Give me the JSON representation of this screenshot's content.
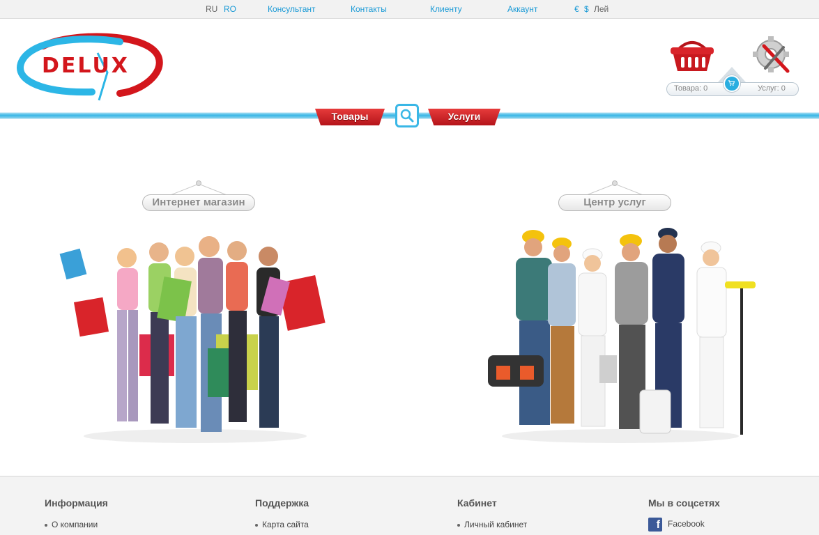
{
  "topbar": {
    "lang_ru": "RU",
    "lang_ro": "RO",
    "consultant": "Консультант",
    "contacts": "Контакты",
    "client": "Клиенту",
    "account": "Аккаунт",
    "cur_eur": "€",
    "cur_usd": "$",
    "cur_lei": "Лей"
  },
  "header": {
    "logo_text": "DELUX",
    "cart_goods": "Товара: 0",
    "cart_services": "Услуг: 0"
  },
  "nav": {
    "goods": "Товары",
    "services": "Услуги"
  },
  "sections": {
    "shop": "Интернет магазин",
    "services": "Центр услуг"
  },
  "footer": {
    "col_info": {
      "title": "Информация",
      "item": "О компании"
    },
    "col_support": {
      "title": "Поддержка",
      "item": "Карта сайта"
    },
    "col_cabinet": {
      "title": "Кабинет",
      "item": "Личный кабинет"
    },
    "col_social": {
      "title": "Мы в соцсетях",
      "item": "Facebook"
    }
  },
  "colors": {
    "accent": "#1a9ad6",
    "nav_blue": "#3ab7e6",
    "tab_red": "#c8191f"
  }
}
